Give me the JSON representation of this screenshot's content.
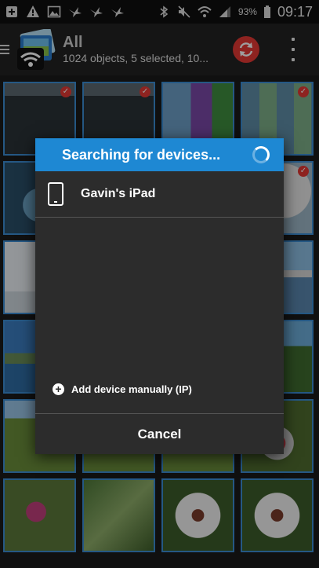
{
  "status_bar": {
    "battery_percent": "93%",
    "time": "09:17",
    "icons": [
      "add-box-icon",
      "warning-icon",
      "image-icon",
      "bird-icon",
      "bird-icon",
      "bird-icon",
      "bluetooth-icon",
      "mute-icon",
      "wifi-icon",
      "signal-icon",
      "battery-icon"
    ]
  },
  "app_bar": {
    "title": "All",
    "subtitle": "1024 objects, 5 selected, 10...",
    "accent": "#e53935"
  },
  "dialog": {
    "title": "Searching for devices...",
    "devices": [
      {
        "name": "Gavin's iPad"
      }
    ],
    "add_device_label": "Add device manually (IP)",
    "cancel_label": "Cancel",
    "header_color": "#1e88d3"
  },
  "gallery": {
    "selected_border_color": "#3d8fd6",
    "tiles": [
      {
        "kind": "screenshot-settings",
        "selected": true
      },
      {
        "kind": "screenshot-settings",
        "selected": true
      },
      {
        "kind": "screenshot-tiles",
        "selected": false
      },
      {
        "kind": "screenshot-photos",
        "selected": true
      },
      {
        "kind": "gauge",
        "selected": false
      },
      {
        "kind": "dark",
        "selected": false
      },
      {
        "kind": "dark",
        "selected": false
      },
      {
        "kind": "gauge-light",
        "selected": true
      },
      {
        "kind": "chart",
        "selected": false
      },
      {
        "kind": "dark",
        "selected": false
      },
      {
        "kind": "dark",
        "selected": false
      },
      {
        "kind": "harbour",
        "selected": false
      },
      {
        "kind": "sea",
        "selected": false
      },
      {
        "kind": "dark",
        "selected": false
      },
      {
        "kind": "dark",
        "selected": false
      },
      {
        "kind": "tree",
        "selected": false
      },
      {
        "kind": "grass",
        "selected": false
      },
      {
        "kind": "grass",
        "selected": false
      },
      {
        "kind": "grass",
        "selected": false
      },
      {
        "kind": "flowers",
        "selected": false
      },
      {
        "kind": "pink-flower",
        "selected": false
      },
      {
        "kind": "plant",
        "selected": false
      },
      {
        "kind": "daisy",
        "selected": false
      },
      {
        "kind": "daisy",
        "selected": false
      }
    ]
  }
}
